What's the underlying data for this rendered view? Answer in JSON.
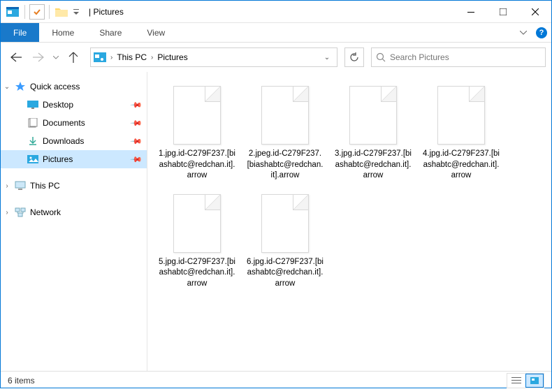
{
  "titlebar": {
    "title_sep": "|",
    "title": "Pictures"
  },
  "ribbon": {
    "file": "File",
    "tabs": [
      "Home",
      "Share",
      "View"
    ]
  },
  "breadcrumb": {
    "items": [
      "This PC",
      "Pictures"
    ]
  },
  "search": {
    "placeholder": "Search Pictures"
  },
  "sidebar": {
    "quick_access": "Quick access",
    "items": [
      {
        "label": "Desktop",
        "icon": "desktop"
      },
      {
        "label": "Documents",
        "icon": "documents"
      },
      {
        "label": "Downloads",
        "icon": "downloads"
      },
      {
        "label": "Pictures",
        "icon": "pictures",
        "selected": true
      }
    ],
    "this_pc": "This PC",
    "network": "Network"
  },
  "files": [
    {
      "name": "1.jpg.id-C279F237.[biashabtc@redchan.it].arrow"
    },
    {
      "name": "2.jpeg.id-C279F237.[biashabtc@redchan.it].arrow"
    },
    {
      "name": "3.jpg.id-C279F237.[biashabtc@redchan.it].arrow"
    },
    {
      "name": "4.jpg.id-C279F237.[biashabtc@redchan.it].arrow"
    },
    {
      "name": "5.jpg.id-C279F237.[biashabtc@redchan.it].arrow"
    },
    {
      "name": "6.jpg.id-C279F237.[biashabtc@redchan.it].arrow"
    }
  ],
  "status": {
    "count": "6 items"
  },
  "colors": {
    "accent": "#0177d6",
    "file_tab": "#1979ca",
    "selection": "#cce8ff"
  }
}
